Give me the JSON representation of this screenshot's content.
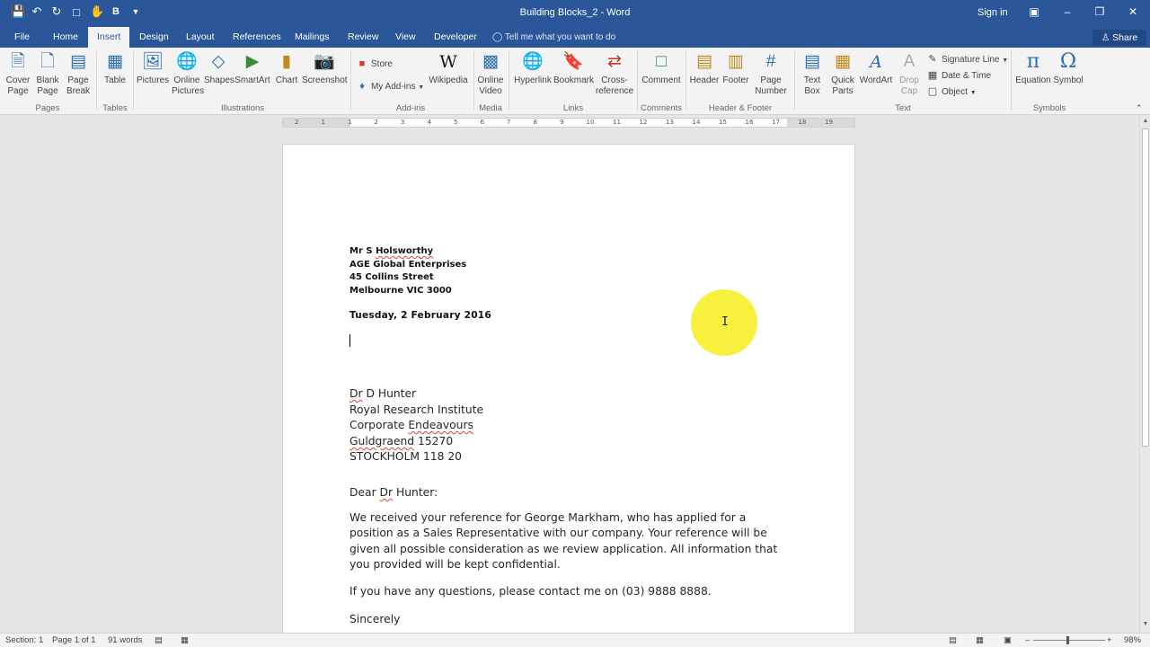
{
  "titlebar": {
    "qat_icons": [
      "save-icon",
      "undo-icon",
      "redo-icon",
      "new-document-icon",
      "touch-mode-icon",
      "bold-icon",
      "customize-qat-icon"
    ],
    "title": "Building Blocks_2 - Word",
    "sign_in": "Sign in"
  },
  "tabs": {
    "file": "File",
    "home": "Home",
    "insert": "Insert",
    "design": "Design",
    "layout": "Layout",
    "references": "References",
    "mailings": "Mailings",
    "review": "Review",
    "view": "View",
    "developer": "Developer",
    "tell_me": "Tell me what you want to do",
    "share": "Share",
    "active": "Insert"
  },
  "ribbon": {
    "pages": {
      "label": "Pages",
      "cover_page": "Cover\nPage",
      "blank_page": "Blank\nPage",
      "page_break": "Page\nBreak"
    },
    "tables": {
      "label": "Tables",
      "table": "Table"
    },
    "illustrations": {
      "label": "Illustrations",
      "pictures": "Pictures",
      "online_pictures": "Online\nPictures",
      "shapes": "Shapes",
      "smartart": "SmartArt",
      "chart": "Chart",
      "screenshot": "Screenshot"
    },
    "addins": {
      "label": "Add-ins",
      "store": "Store",
      "my_addins": "My Add-ins",
      "wikipedia": "Wikipedia"
    },
    "media": {
      "label": "Media",
      "online_video": "Online\nVideo"
    },
    "links": {
      "label": "Links",
      "hyperlink": "Hyperlink",
      "bookmark": "Bookmark",
      "cross_reference": "Cross-\nreference"
    },
    "comments": {
      "label": "Comments",
      "comment": "Comment"
    },
    "header_footer": {
      "label": "Header & Footer",
      "header": "Header",
      "footer": "Footer",
      "page_number": "Page\nNumber"
    },
    "text": {
      "label": "Text",
      "text_box": "Text\nBox",
      "quick_parts": "Quick\nParts",
      "wordart": "WordArt",
      "drop_cap": "Drop\nCap",
      "signature_line": "Signature Line",
      "date_time": "Date & Time",
      "object": "Object"
    },
    "symbols": {
      "label": "Symbols",
      "equation": "Equation",
      "symbol": "Symbol"
    }
  },
  "ruler": {
    "marks": [
      "2",
      "1",
      "1",
      "2",
      "3",
      "4",
      "5",
      "6",
      "7",
      "8",
      "9",
      "10",
      "11",
      "12",
      "13",
      "14",
      "15",
      "16",
      "17",
      "18",
      "19"
    ]
  },
  "document": {
    "sender": [
      "Mr S Holsworthy",
      "AGE Global Enterprises",
      "45 Collins Street",
      "Melbourne VIC 3000"
    ],
    "date": "Tuesday, 2 February 2016",
    "recipient": [
      "Dr D Hunter",
      "Royal Research Institute",
      "Corporate Endeavours",
      "Guldgraend 15270",
      "STOCKHOLM 118 20"
    ],
    "salutation": "Dear Dr Hunter:",
    "paragraph1": [
      "We received your reference for George Markham, who has applied for a",
      "position as a Sales Representative with our company. Your reference will be",
      "given all possible consideration as we review application. All information that",
      "you provided will be kept confidential."
    ],
    "paragraph2": "If you have any questions, please contact me on (03) 9888 8888.",
    "closing": "Sincerely"
  },
  "status": {
    "section": "Section: 1",
    "page": "Page 1 of 1",
    "words": "91 words",
    "zoom": "98%"
  },
  "colors": {
    "brand": "#2b579a",
    "highlight": "#f7ee2a",
    "squiggle": "#e04040"
  }
}
